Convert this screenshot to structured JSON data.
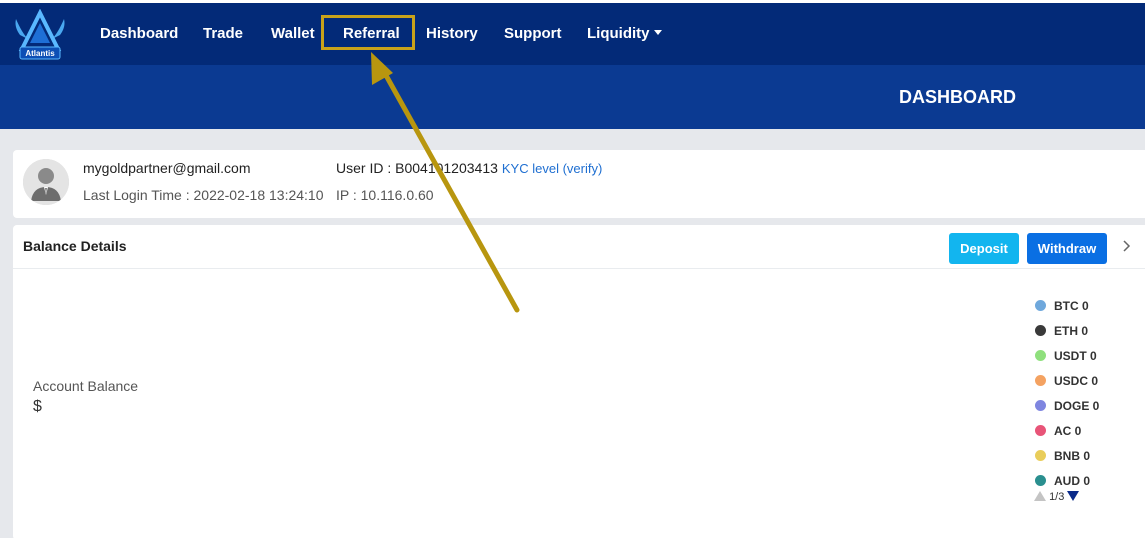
{
  "nav": {
    "logo_text": "Atlantis",
    "items": [
      "Dashboard",
      "Trade",
      "Wallet",
      "Referral",
      "History",
      "Support",
      "Liquidity"
    ],
    "highlighted": "Referral"
  },
  "banner": {
    "title": "DASHBOARD"
  },
  "profile": {
    "email": "mygoldpartner@gmail.com",
    "last_login": "Last Login Time : 2022-02-18 13:24:10",
    "user_id": "User ID : B004101203413",
    "kyc": "KYC level (verify)",
    "ip": "IP : 10.116.0.60"
  },
  "balance": {
    "title": "Balance Details",
    "deposit_label": "Deposit",
    "withdraw_label": "Withdraw",
    "account_label": "Account Balance",
    "account_value": "$",
    "legend": [
      {
        "label": "BTC 0",
        "color": "#6fa8dc"
      },
      {
        "label": "ETH 0",
        "color": "#3a3a3a"
      },
      {
        "label": "USDT 0",
        "color": "#8fe07d"
      },
      {
        "label": "USDC 0",
        "color": "#f4a261"
      },
      {
        "label": "DOGE 0",
        "color": "#7f86e0"
      },
      {
        "label": "AC 0",
        "color": "#e85478"
      },
      {
        "label": "BNB 0",
        "color": "#e9cd5a"
      },
      {
        "label": "AUD 0",
        "color": "#2a8f8f"
      }
    ],
    "pager": "1/3"
  },
  "colors": {
    "navbar": "#032a78",
    "banner": "#0b3a92",
    "highlight": "#c9a21a",
    "deposit": "#12b5ef",
    "withdraw": "#0a6fe3"
  }
}
